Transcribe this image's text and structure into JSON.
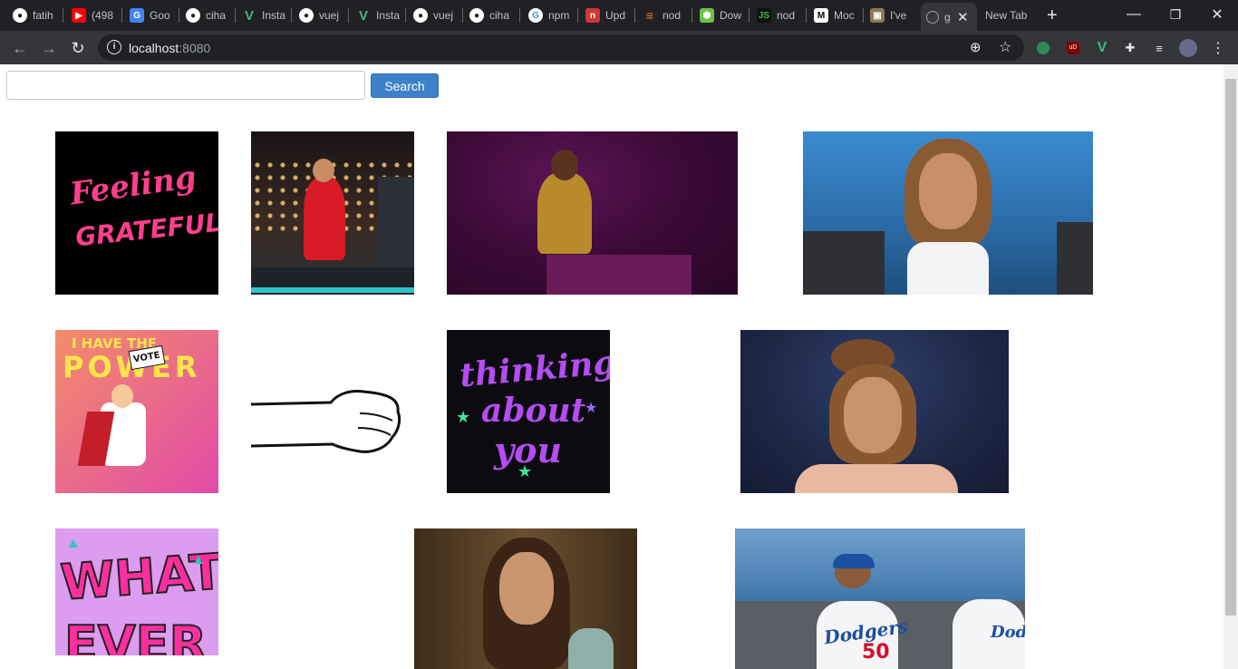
{
  "browser": {
    "tabs": [
      {
        "label": "fatih",
        "icon": "github-icon"
      },
      {
        "label": "(498",
        "icon": "youtube-icon"
      },
      {
        "label": "Goo",
        "icon": "google-translate-icon"
      },
      {
        "label": "ciha",
        "icon": "github-icon"
      },
      {
        "label": "Insta",
        "icon": "vue-icon"
      },
      {
        "label": "vuej",
        "icon": "github-icon"
      },
      {
        "label": "Insta",
        "icon": "vue-icon"
      },
      {
        "label": "vuej",
        "icon": "github-icon"
      },
      {
        "label": "ciha",
        "icon": "github-icon"
      },
      {
        "label": "npm",
        "icon": "google-icon"
      },
      {
        "label": "Upd",
        "icon": "npm-icon"
      },
      {
        "label": "nod",
        "icon": "stackoverflow-icon"
      },
      {
        "label": "Dow",
        "icon": "nodejs-icon"
      },
      {
        "label": "nod",
        "icon": "nodejs-green-icon"
      },
      {
        "label": "Moc",
        "icon": "medium-icon"
      },
      {
        "label": "I've",
        "icon": "picture-icon"
      },
      {
        "label": "g",
        "icon": "globe-icon"
      },
      {
        "label": "New Tab",
        "icon": ""
      }
    ],
    "url_host": "localhost",
    "url_port": ":8080"
  },
  "search": {
    "placeholder": "",
    "value": "",
    "button_label": "Search"
  },
  "gifs": [
    {
      "name": "gif-feeling-grateful",
      "text_lines": [
        "Feeling",
        "GRATEFUL"
      ]
    },
    {
      "name": "gif-woman-dancing-red-dress"
    },
    {
      "name": "gif-woman-purple-stage"
    },
    {
      "name": "gif-woman-earrings-blue-stage"
    },
    {
      "name": "gif-i-have-the-power",
      "text_lines": [
        "I HAVE THE",
        "POWER",
        "VOTE"
      ]
    },
    {
      "name": "gif-fist-drawing"
    },
    {
      "name": "gif-thinking-about-you",
      "text_lines": [
        "thinking",
        "about",
        "you"
      ]
    },
    {
      "name": "gif-woman-hair-bun"
    },
    {
      "name": "gif-whatever",
      "text_lines": [
        "WHAT",
        "EVER"
      ]
    },
    {
      "name": "gif-woman-surprised"
    },
    {
      "name": "gif-baseball-dodgers",
      "text_lines": [
        "Dodgers",
        "50",
        "Dodg"
      ]
    }
  ],
  "colors": {
    "search_button": "#3d82c8",
    "browser_dark": "#202124",
    "toolbar": "#35363a"
  }
}
